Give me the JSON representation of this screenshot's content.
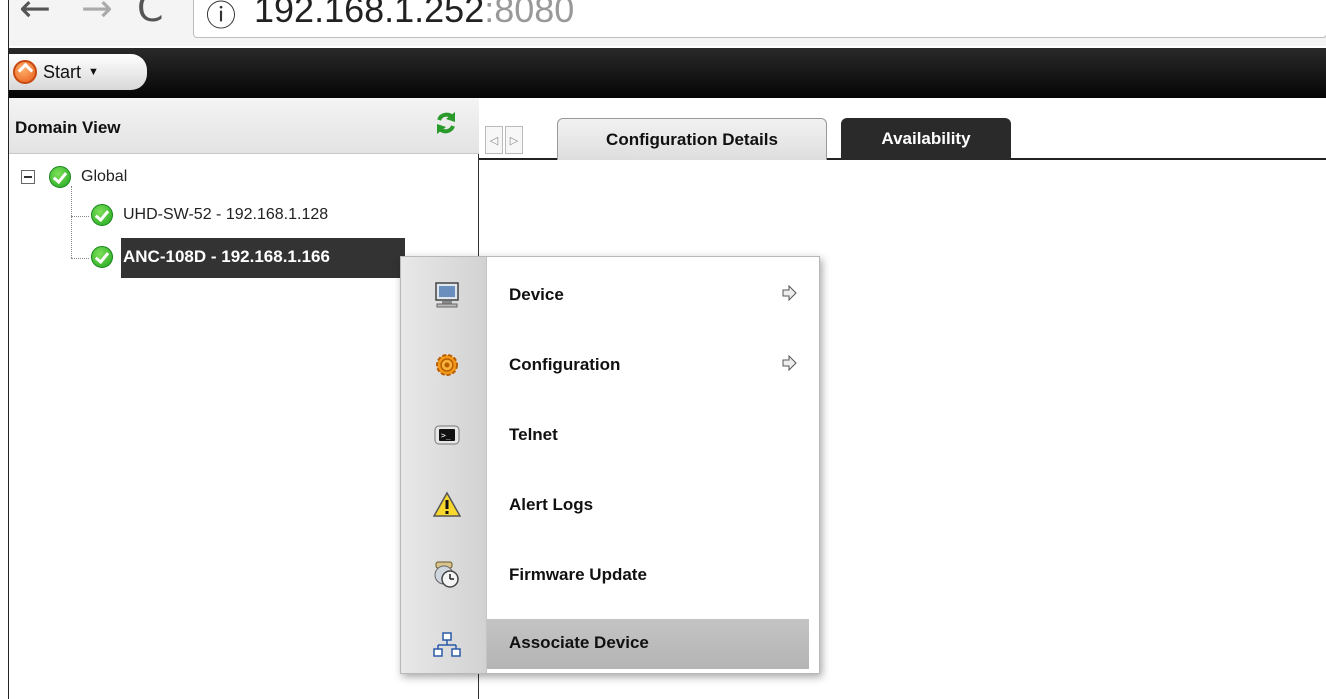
{
  "browser": {
    "back": "←",
    "forward": "→",
    "reload": "C",
    "info_icon": "ⓘ",
    "address_host": "192.168.1.252",
    "address_port": ":8080"
  },
  "toolbar": {
    "start_label": "Start",
    "start_caret": "▼"
  },
  "domain_view": {
    "title": "Domain View",
    "tree": {
      "root": {
        "label": "Global",
        "status": "ok"
      },
      "children": [
        {
          "label": "UHD-SW-52 - 192.168.1.128",
          "status": "ok",
          "selected": false
        },
        {
          "label": "ANC-108D - 192.168.1.166",
          "status": "ok",
          "selected": true
        }
      ]
    }
  },
  "tabs": {
    "prev_arrow": "◁",
    "next_arrow": "▷",
    "items": [
      {
        "label": "Configuration Details",
        "active": false
      },
      {
        "label": "Availability",
        "active": true
      }
    ]
  },
  "context_menu": {
    "items": [
      {
        "label": "Device",
        "icon": "monitor-icon",
        "has_submenu": true
      },
      {
        "label": "Configuration",
        "icon": "gear-icon",
        "has_submenu": true
      },
      {
        "label": "Telnet",
        "icon": "terminal-icon",
        "has_submenu": false
      },
      {
        "label": "Alert Logs",
        "icon": "warning-icon",
        "has_submenu": false
      },
      {
        "label": "Firmware Update",
        "icon": "clock-update-icon",
        "has_submenu": false
      },
      {
        "label": "Associate Device",
        "icon": "network-icon",
        "has_submenu": false,
        "hovered": true
      }
    ]
  },
  "colors": {
    "toolbar_bg": "#111111",
    "status_ok": "#22aa22",
    "selected_bg": "#333333",
    "active_tab_bg": "#2a2a2a"
  }
}
